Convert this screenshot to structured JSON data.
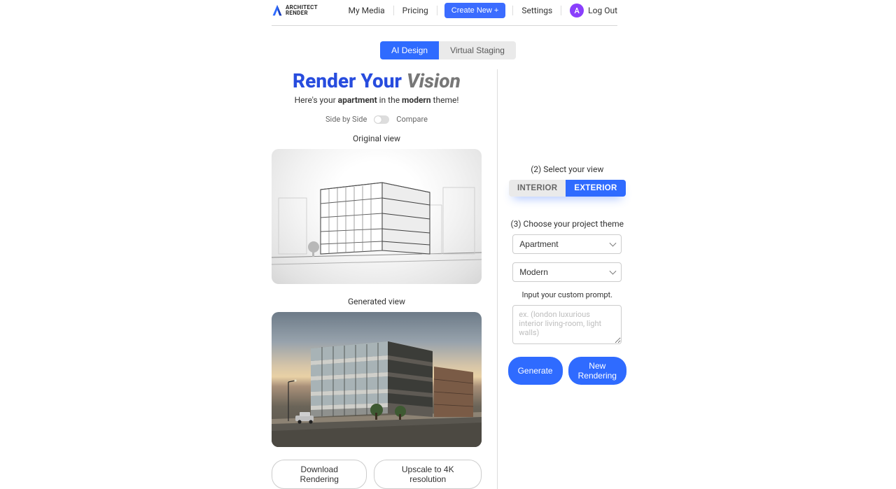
{
  "brand": {
    "line1": "ARCHITECT",
    "line2": "RENDER"
  },
  "nav": {
    "my_media": "My Media",
    "pricing": "Pricing",
    "create_new": "Create New +",
    "settings": "Settings",
    "avatar_letter": "A",
    "logout": "Log Out"
  },
  "tabs": {
    "ai_design": "AI Design",
    "virtual_staging": "Virtual Staging"
  },
  "hero": {
    "title_a": "Render Your ",
    "title_b": "Vision",
    "sub_a": "Here's your ",
    "sub_b": "apartment",
    "sub_c": " in the ",
    "sub_d": "modern",
    "sub_e": " theme!"
  },
  "toggle": {
    "side_by_side": "Side by Side",
    "compare": "Compare"
  },
  "views": {
    "original": "Original view",
    "generated": "Generated view"
  },
  "actions": {
    "download": "Download Rendering",
    "upscale": "Upscale to 4K resolution"
  },
  "steps": {
    "select_view": "(2) Select your view",
    "interior": "INTERIOR",
    "exterior": "EXTERIOR",
    "choose_theme": "(3) Choose your project theme",
    "project_type": "Apartment",
    "style": "Modern",
    "prompt_help": "Input your custom prompt.",
    "prompt_placeholder": "ex. (london luxurious interior living-room, light walls)",
    "generate": "Generate",
    "new_rendering": "New Rendering"
  }
}
